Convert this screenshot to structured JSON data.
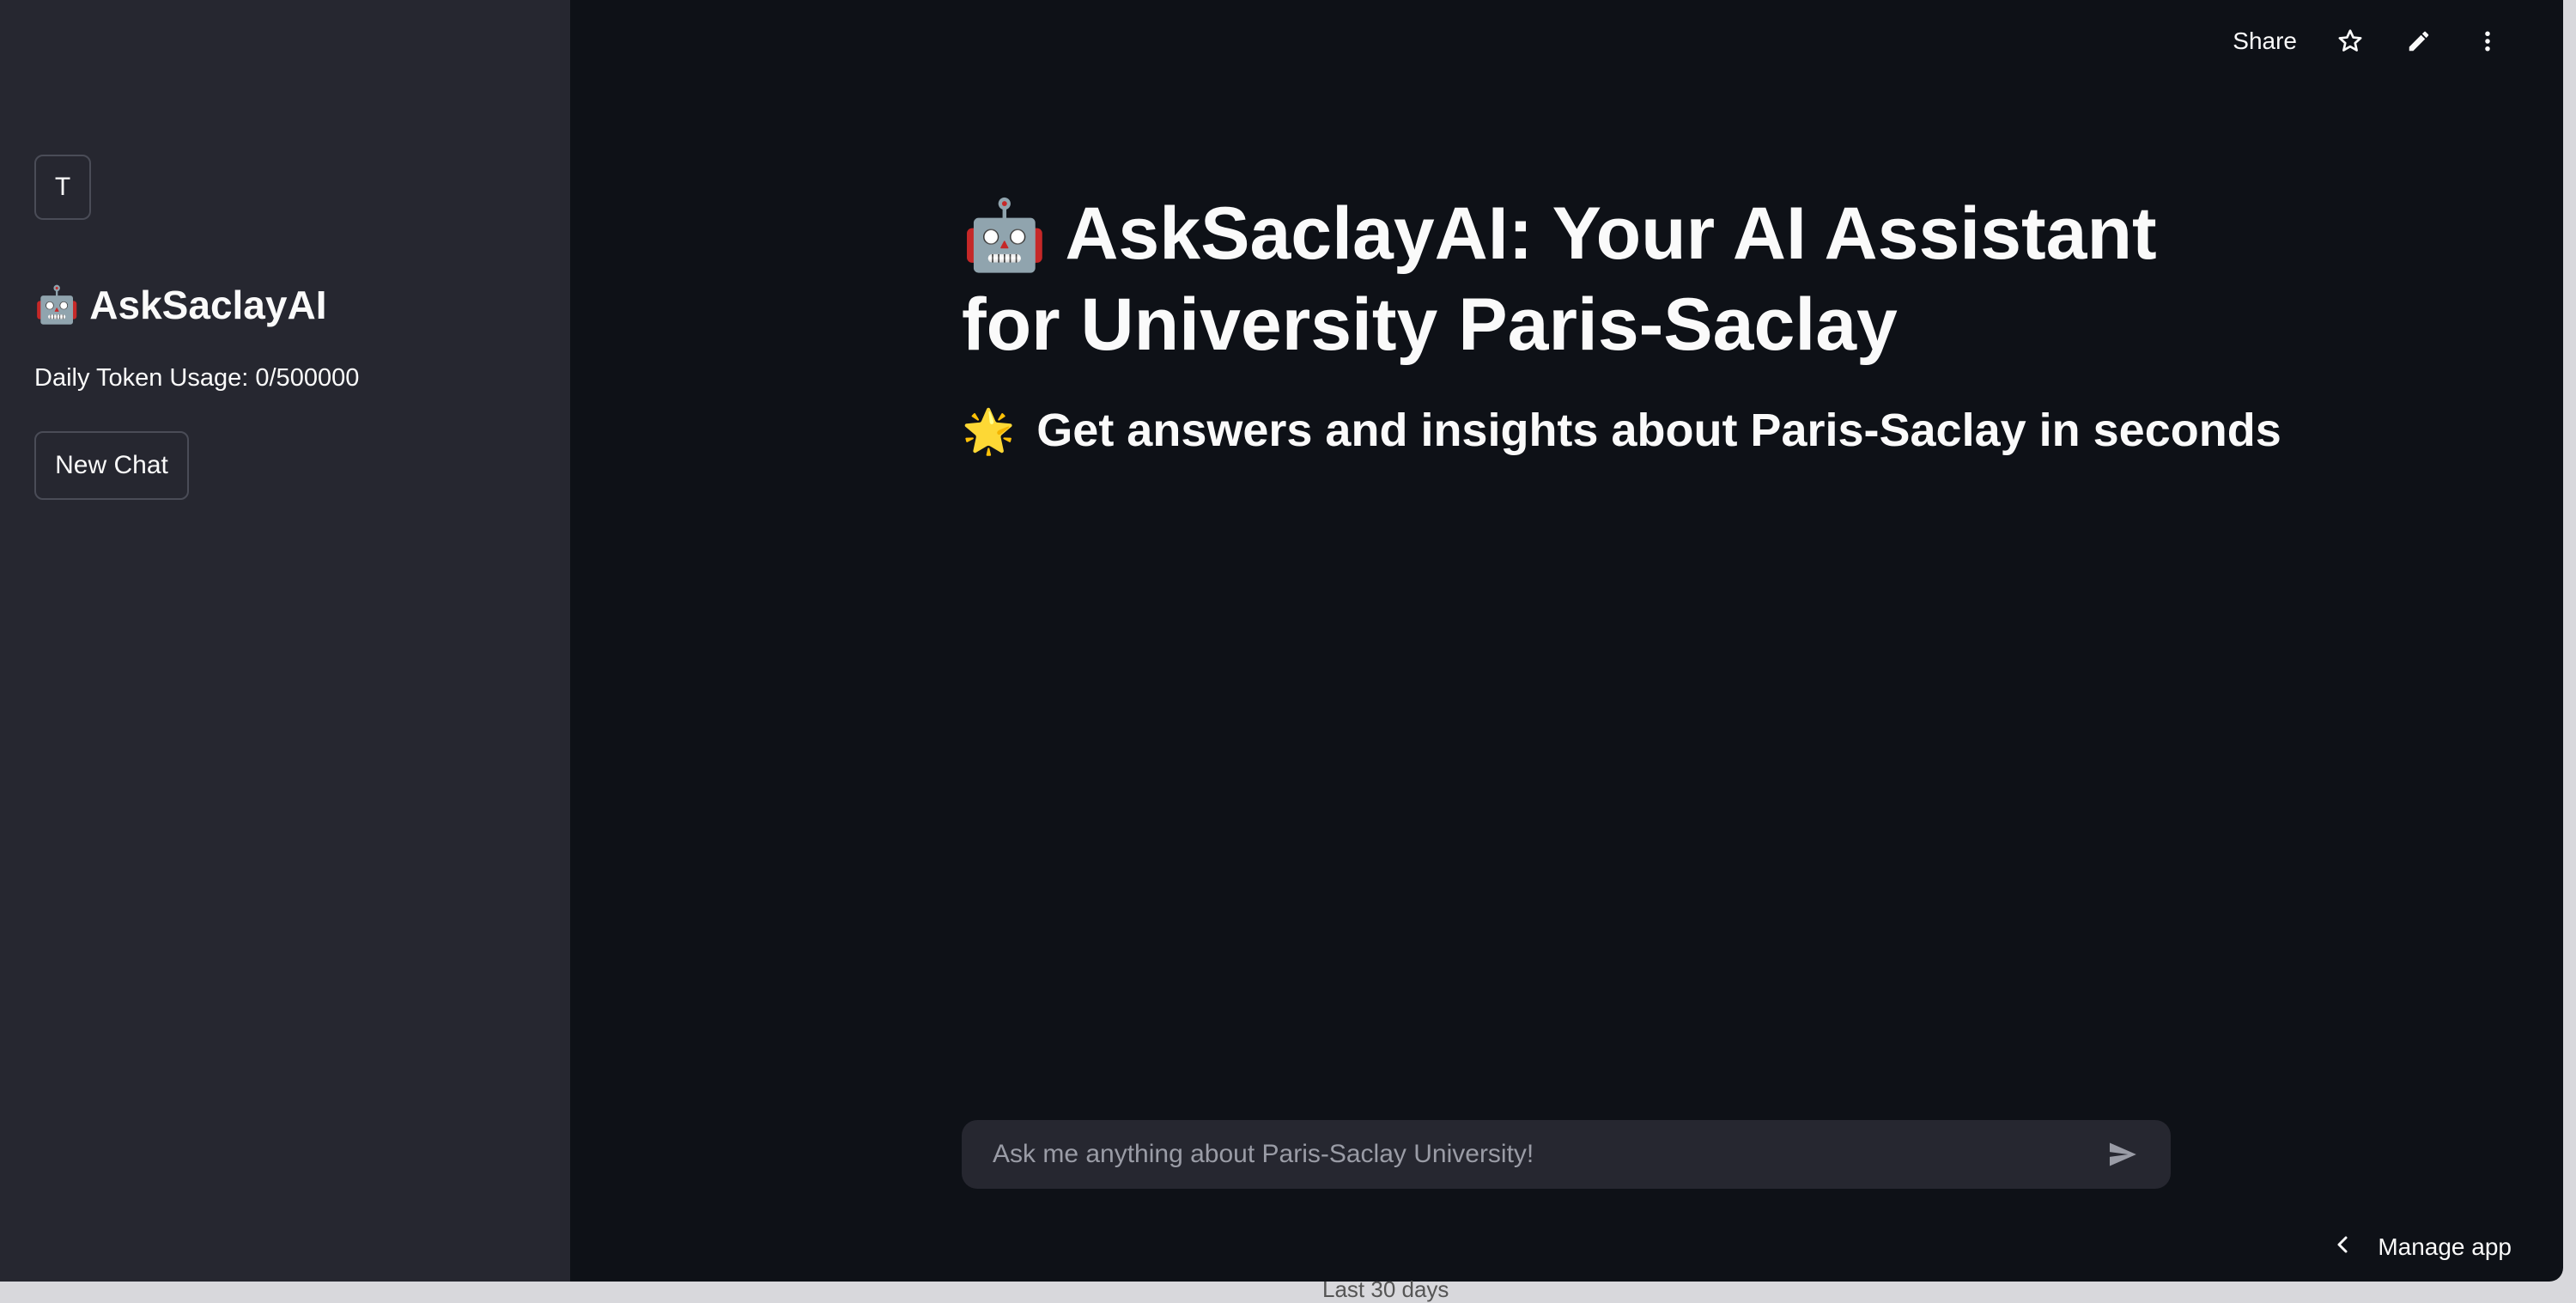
{
  "sidebar": {
    "avatar_letter": "T",
    "title_emoji": "🤖",
    "title": "AskSaclayAI",
    "token_usage": "Daily Token Usage: 0/500000",
    "new_chat_label": "New Chat"
  },
  "toolbar": {
    "share_label": "Share",
    "icons": [
      "star-icon",
      "pencil-icon",
      "more-vertical-icon"
    ]
  },
  "main": {
    "title_emoji": "🤖",
    "title": "AskSaclayAI: Your AI Assistant for University Paris-Saclay",
    "subtitle_emoji": "🌟",
    "subtitle": "Get answers and insights about Paris-Saclay in seconds"
  },
  "chat": {
    "placeholder": "Ask me anything about Paris-Saclay University!",
    "value": ""
  },
  "footer": {
    "manage_app_label": "Manage app",
    "background_text": "Last 30 days"
  },
  "colors": {
    "main_bg": "#0e1117",
    "sidebar_bg": "#262730",
    "text": "#fafafa",
    "input_bg": "#262730"
  }
}
